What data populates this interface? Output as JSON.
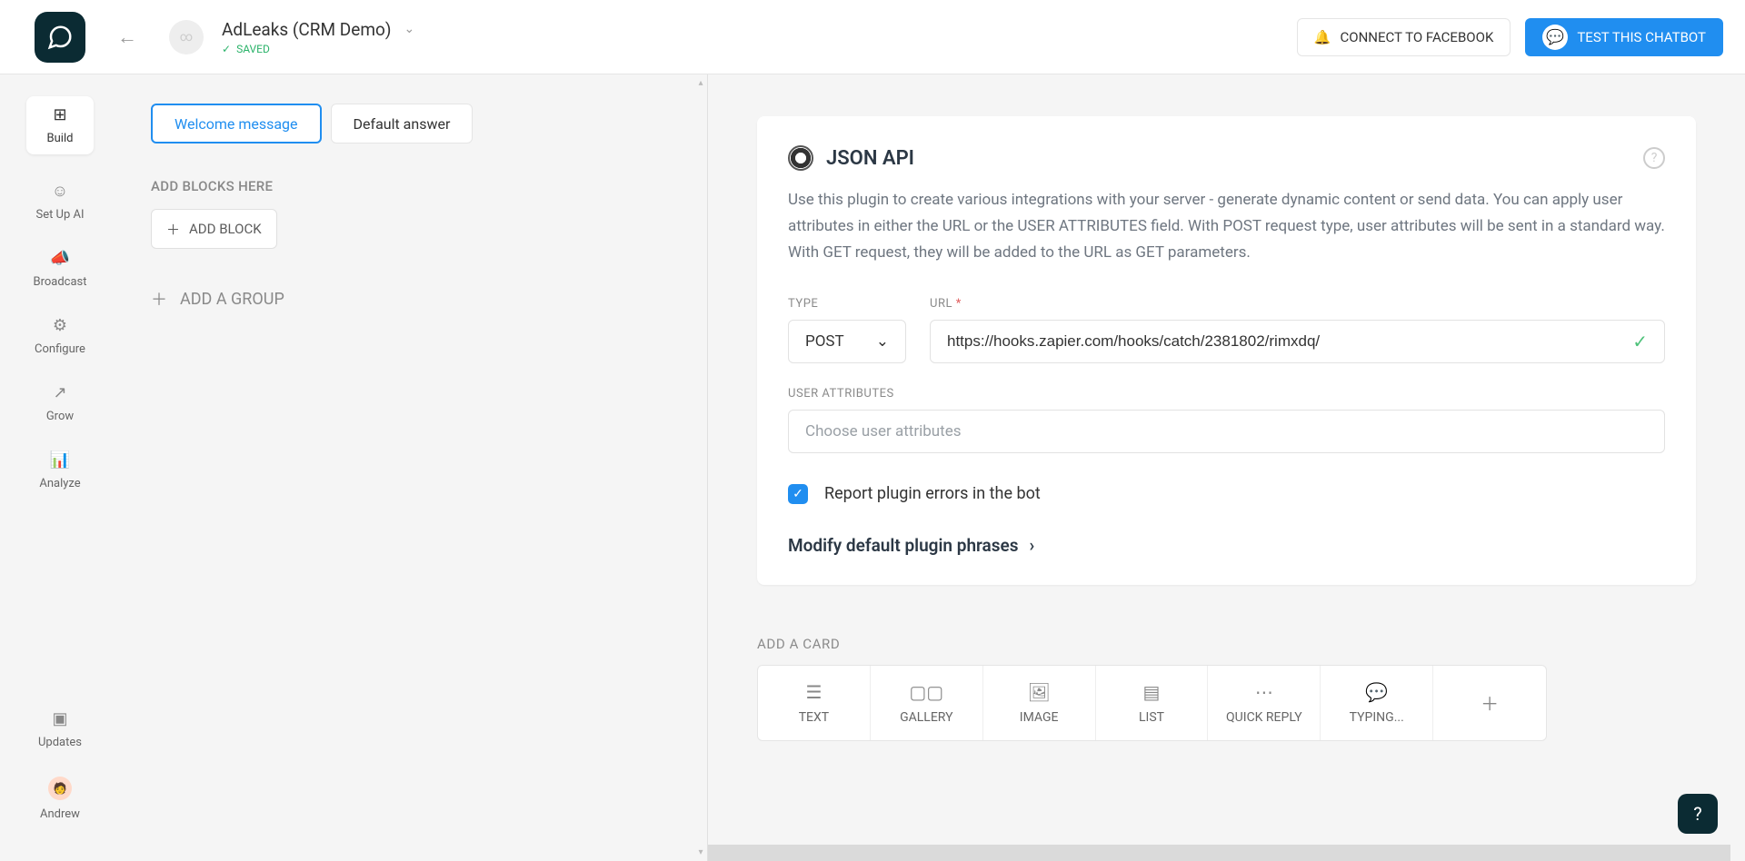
{
  "header": {
    "bot_name": "AdLeaks (CRM Demo)",
    "saved_label": "SAVED",
    "connect_fb_label": "CONNECT TO FACEBOOK",
    "test_chatbot_label": "TEST THIS CHATBOT"
  },
  "sidebar": {
    "build": "Build",
    "setup_ai": "Set Up AI",
    "broadcast": "Broadcast",
    "configure": "Configure",
    "grow": "Grow",
    "analyze": "Analyze",
    "updates": "Updates",
    "user_name": "Andrew"
  },
  "blocks_pane": {
    "welcome_message": "Welcome message",
    "default_answer": "Default answer",
    "add_blocks_here": "ADD BLOCKS HERE",
    "add_block": "ADD BLOCK",
    "add_a_group": "ADD A GROUP"
  },
  "json_api": {
    "title": "JSON API",
    "description": "Use this plugin to create various integrations with your server - generate dynamic content or send data. You can apply user attributes in either the URL or the USER ATTRIBUTES field. With POST request type, user attributes will be sent in a standard way. With GET request, they will be added to the URL as GET parameters.",
    "type_label": "TYPE",
    "type_value": "POST",
    "url_label": "URL",
    "url_value": "https://hooks.zapier.com/hooks/catch/2381802/rimxdq/",
    "user_attributes_label": "USER ATTRIBUTES",
    "user_attributes_placeholder": "Choose user attributes",
    "report_errors_label": "Report plugin errors in the bot",
    "modify_phrases_label": "Modify default plugin phrases"
  },
  "add_card": {
    "label": "ADD A CARD",
    "text": "TEXT",
    "gallery": "GALLERY",
    "image": "IMAGE",
    "list": "LIST",
    "quick_reply": "QUICK REPLY",
    "typing": "TYPING..."
  }
}
